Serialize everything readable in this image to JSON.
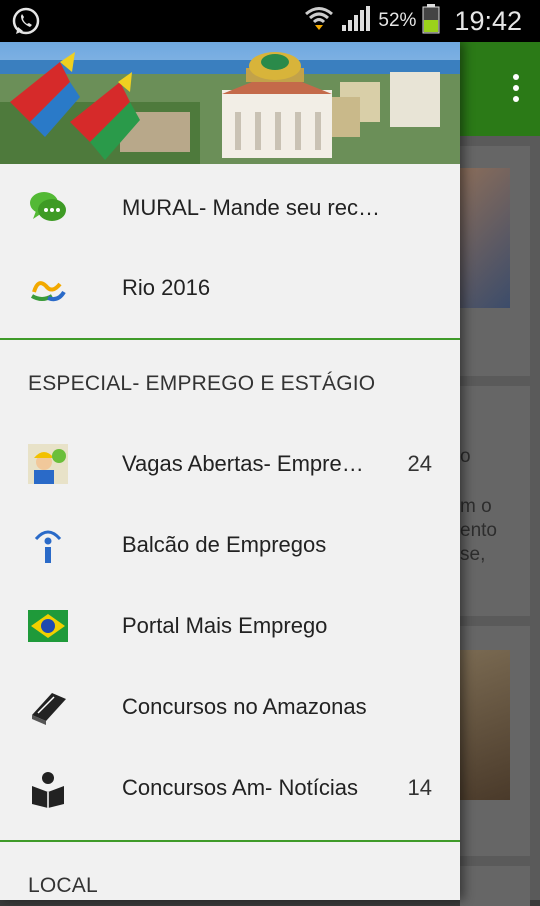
{
  "status_bar": {
    "battery_percent": "52%",
    "time": "19:42",
    "icons": [
      "whatsapp-icon",
      "wifi-icon",
      "signal-icon",
      "battery-icon"
    ]
  },
  "background_app": {
    "cards": [
      {
        "lines": []
      },
      {
        "lines": [
          "o",
          "m o",
          "ento",
          "se,"
        ]
      },
      {
        "lines": []
      }
    ]
  },
  "drawer": {
    "header_image": "banner",
    "items_top": [
      {
        "label": "MURAL- Mande seu recado!",
        "icon": "chat-bubbles-icon"
      },
      {
        "label": "Rio 2016",
        "icon": "rio-2016-logo-icon"
      }
    ],
    "section_1": {
      "title": "ESPECIAL- EMPREGO E ESTÁGIO",
      "items": [
        {
          "label": "Vagas Abertas- Empre…",
          "count": "24",
          "icon": "worker-icon"
        },
        {
          "label": "Balcão de Empregos",
          "count": "",
          "icon": "info-icon"
        },
        {
          "label": "Portal Mais Emprego",
          "count": "",
          "icon": "brazil-flag-icon"
        },
        {
          "label": "Concursos no Amazonas",
          "count": "",
          "icon": "book-icon"
        },
        {
          "label": "Concursos Am- Notícias",
          "count": "14",
          "icon": "reader-icon"
        }
      ]
    },
    "section_2": {
      "title": "LOCAL"
    }
  },
  "colors": {
    "accent": "#3f9b2a",
    "app_bar": "#2b7a17",
    "drawer_bg": "#f1f1f1"
  }
}
